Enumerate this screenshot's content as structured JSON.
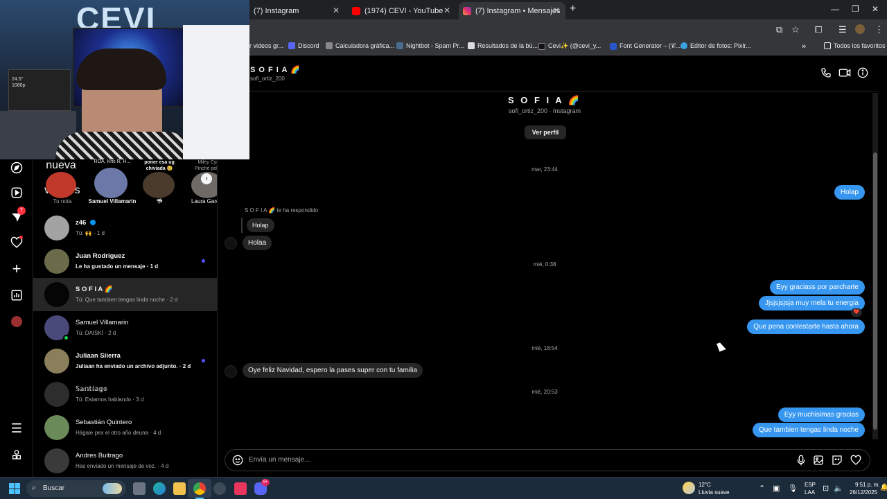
{
  "browser": {
    "tabs": [
      {
        "title": "(7) Instagram",
        "active": false
      },
      {
        "title": "(1974) CEVI - YouTube",
        "active": false
      },
      {
        "title": "(7) Instagram • Mensajes",
        "active": true
      }
    ],
    "bookmarks": [
      "r videos gr...",
      "Discord",
      "Calculadora gráfica...",
      "Nightbot - Spam Pr...",
      "Resultados de la bú...",
      "Cevi✨ (@cevi_y...",
      "Font Generator – (𝒞...",
      "Editor de fotos: Pixlr...",
      "Todos los favoritos"
    ]
  },
  "webcam": {
    "sign_text": "CEVI",
    "monitor_text": "24.5\" 1080p"
  },
  "notes": [
    {
      "bubble": "nueva de viernes",
      "label": "Tu nota"
    },
    {
      "bubble": "ROA, Kris R, H...",
      "label": "Samuel Villamarin"
    },
    {
      "bubble": "poner esa ug chiviada 🥺",
      "label": "🦈"
    },
    {
      "bubble": "Miley Cyru Pinché pelícu",
      "label": "Laura Garc"
    }
  ],
  "nav": {
    "notifications_badge": "7"
  },
  "conversations": [
    {
      "name": "z46",
      "preview": "Tú: 🙌 · 1 d",
      "verified": true,
      "unread": false
    },
    {
      "name": "Juan Rodriguez",
      "preview": "Le ha gustado un mensaje · 1 d",
      "unread": true
    },
    {
      "name": "S O F I A 🌈",
      "preview": "Tú: Que tambien tengas linda noche · 2 d",
      "selected": true,
      "unread": false
    },
    {
      "name": "Samuel Villamarin",
      "preview": "Tú: DAISKI · 2 d",
      "online": true,
      "unread": false
    },
    {
      "name": "Juliaan Siierra",
      "preview": "Juliaan ha enviado un archivo adjunto. · 2 d",
      "unread": true
    },
    {
      "name": "𝕊𝕒𝕟𝕥𝕚𝕒𝕘𝕠",
      "preview": "Tú: Estamos hablando · 3 d",
      "unread": false
    },
    {
      "name": "Sebastián Quintero",
      "preview": "Hágale pex el otro año deuna · 4 d",
      "unread": false
    },
    {
      "name": "Andres Buitrago",
      "preview": "Has enviado un mensaje de voz. · 4 d",
      "unread": false
    }
  ],
  "chat": {
    "header_name": "S O F I A 🌈",
    "header_username": "sofi_ortiz_200",
    "profile_name": "S O F I A 🌈",
    "profile_sub": "sofi_ortiz_200 · Instagram",
    "view_profile": "Ver perfil",
    "timestamps": [
      "mar, 23:44",
      "mié, 0:38",
      "mié, 18:54",
      "mié, 20:53"
    ],
    "reply_label": "S O F I A 🌈 te ha respondido",
    "messages": {
      "out1": "Holap",
      "quoted": "Holap",
      "in1": "Holaa",
      "out2": "Eyy graciass por parcharte",
      "out3": "Jjsjsjsjsja muy mela tu energia",
      "reaction": "❤️",
      "out4": "Que pena contestarte hasta ahora",
      "in2": "Oye feliz Navidad, espero la pases super con tu familia",
      "out5": "Eyy muchisimas gracias",
      "out6": "Que tambien tengas linda noche"
    },
    "composer_placeholder": "Envía un mensaje..."
  },
  "taskbar": {
    "search_placeholder": "Buscar",
    "weather_temp": "12°C",
    "weather_desc": "Lluvia suave",
    "lang_1": "ESP",
    "lang_2": "LAA",
    "time": "9:51 p. m.",
    "date": "26/12/2025",
    "discord_badge": "9+"
  },
  "colors": {
    "accent_blue": "#3797f0",
    "unread_dot": "#5551ff",
    "online_green": "#1cd14f"
  }
}
